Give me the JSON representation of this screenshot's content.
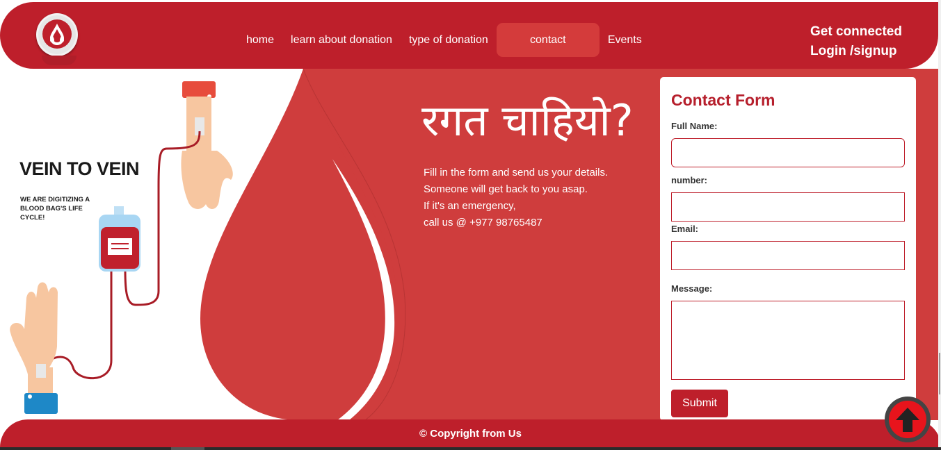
{
  "header": {
    "logo_icon": "blood-drop-logo-icon",
    "nav": [
      {
        "label": "home"
      },
      {
        "label": "learn about donation"
      },
      {
        "label": "type of donation"
      },
      {
        "label": "contact",
        "active": true
      },
      {
        "label": "Events"
      }
    ],
    "get_connected": "Get connected",
    "login_signup": "Login /signup"
  },
  "hero": {
    "illustration": {
      "title": "VEIN TO VEIN",
      "subtitle": "WE ARE DIGITIZING A BLOOD BAG'S LIFE CYCLE!"
    },
    "title": "रगत चाहियो?",
    "lines": [
      "Fill in the form and send us your details.",
      "Someone will get back to you asap.",
      "If it's an emergency,",
      "call us @ +977 98765487"
    ]
  },
  "form": {
    "title": "Contact Form",
    "full_name_label": "Full Name:",
    "number_label": "number:",
    "email_label": "Email:",
    "message_label": "Message:",
    "submit_label": "Submit"
  },
  "footer": {
    "copyright": "© Copyright from Us"
  },
  "scroll_top_icon": "arrow-up-icon",
  "colors": {
    "brand_red": "#be1f2b",
    "hero_red": "#cf3d3d",
    "nav_active": "#d43b3b",
    "scroll_button": "#e8141c"
  }
}
